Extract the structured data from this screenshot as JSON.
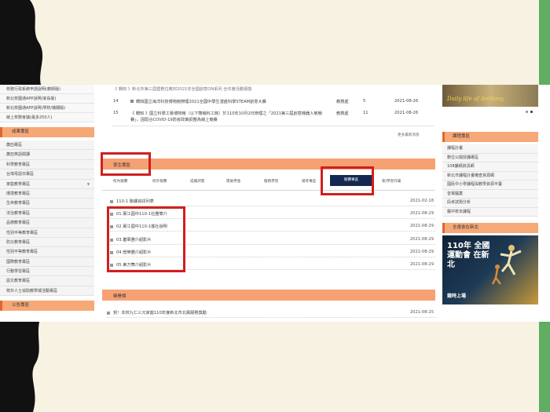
{
  "colors": {
    "accent_orange": "#f6a174",
    "active_tab": "#14294f",
    "highlight_red": "#d11f1f",
    "right_stripe": "#5fae63"
  },
  "left": {
    "top_links": [
      "校務行政系統申請說明(教師版)",
      "新北校園通APP說明(家長版)",
      "新北校園通APP說明(學校/機關版)",
      "線上校務會議(最多250人)"
    ],
    "section_title": "成果專區",
    "categories": [
      "蕭亞專區",
      "蕭亞英語閱讀",
      "科學教育專區",
      "台灣母語日專區",
      "家庭教育專區",
      "環境教育專區",
      "生命教育專區",
      "法治教育專區",
      "品德教育專區",
      "性別平等教育專區",
      "防災教育專區",
      "性別平等教育專區",
      "國際教育專區",
      "行動學習專區",
      "語文教育專區",
      "校外人士協助教學或活動專區"
    ],
    "bottom_title": "公告專區"
  },
  "news": [
    {
      "no": "",
      "title": "《 轉知 》新北市第三屆暨數位教材2021年全國創意ON系列 全年度活動頒獎",
      "unit": "教務處",
      "count": "",
      "date": "2021-08-26"
    },
    {
      "no": "14",
      "title": "轉知國立海洋科技博物館辦理2021全國中學生潛盛科學STEAM創意大賽",
      "unit": "教務處",
      "count": "5",
      "date": "2021-08-26"
    },
    {
      "no": "15",
      "title": "《 轉知 》國立科學工藝博物館（以下簡稱科工館）於110年10月2日辦理之「2021第三屆創意機器人競戰賽」，因配合COVID-19防疫政策調整為線上競賽",
      "unit": "教務處",
      "count": "11",
      "date": "2021-08-26"
    }
  ],
  "more_link": "更多最新消息",
  "student_section": {
    "title": "學生專區",
    "tabs": [
      "校內競賽",
      "校外競賽",
      "成績評量",
      "獎助學金",
      "服務學習",
      "補考專區",
      "競賽專區",
      "家/學習作業"
    ],
    "active_tab": "競賽專區",
    "items": [
      {
        "title": "110-1 聯課資訊列表",
        "date": "2021-02-18"
      },
      {
        "title": "01.黨江國中110-1社團簡介",
        "date": "2021-08-29"
      },
      {
        "title": "02.黨江國中110-1擺社說明",
        "date": "2021-08-29"
      },
      {
        "title": "03.童軍團介紹影片",
        "date": "2021-08-29"
      },
      {
        "title": "04.管樂團介紹影片",
        "date": "2021-08-29"
      },
      {
        "title": "05.東方舞介紹影片",
        "date": "2021-08-29"
      }
    ]
  },
  "honor_section": {
    "title": "榮譽榜",
    "items": [
      {
        "title": "賀！本校九仁三元家庭110年度新北市北鳳服務獎勵",
        "date": "2021-08-25"
      }
    ]
  },
  "right": {
    "banner_text": "Daily life of Anthony",
    "course_title": "課程專區",
    "course_items": [
      "課程計畫",
      "數位公開授課專區",
      "108課綱資訊網",
      "新北市課程計畫備查資源網",
      "國民中小學課程與教學資源平臺",
      "音電腦業",
      "段考試題分析",
      "醫中校本課程"
    ],
    "sports_title": "全運會在新北",
    "sports_banner": "110年 全國運動會 在新北",
    "sports_tag": "競時上場"
  }
}
